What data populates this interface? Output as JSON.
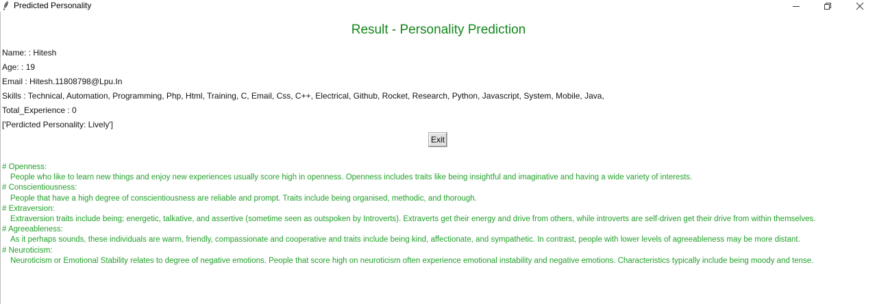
{
  "window": {
    "title": "Predicted Personality",
    "app_icon": "feather-icon",
    "controls": {
      "minimize_icon": "minimize-icon",
      "restore_icon": "restore-icon",
      "close_icon": "close-icon"
    }
  },
  "heading": "Result - Personality Prediction",
  "info": {
    "name": "Name: : Hitesh",
    "age": "Age: : 19",
    "email": "Email : Hitesh.11808798@Lpu.In",
    "skills": "Skills : Technical, Automation, Programming, Php, Html, Training, C, Email, Css, C++, Electrical, Github, Rocket, Research, Python, Javascript, System, Mobile, Java,",
    "experience": "Total_Experience : 0",
    "prediction": "['Perdicted Personality: Lively']"
  },
  "exit_button": "Exit",
  "traits": [
    {
      "header": "# Openness:",
      "body": "People who like to learn new things and enjoy new experiences usually score high in openness. Openness includes traits like being insightful and imaginative and having a wide variety of interests."
    },
    {
      "header": "# Conscientiousness:",
      "body": "People that have a high degree of conscientiousness are reliable and prompt. Traits include being organised, methodic, and thorough."
    },
    {
      "header": "# Extraversion:",
      "body": "Extraversion traits include being; energetic, talkative, and assertive (sometime seen as outspoken by Introverts). Extraverts get their energy and drive from others, while introverts are self-driven get their drive from within themselves."
    },
    {
      "header": "# Agreeableness:",
      "body": "As it perhaps sounds, these individuals are warm, friendly, compassionate and cooperative and traits include being kind, affectionate, and sympathetic. In contrast, people with lower levels of agreeableness may be more distant."
    },
    {
      "header": "# Neuroticism:",
      "body": "Neuroticism or Emotional Stability relates to degree of negative emotions. People that score high on neuroticism often experience emotional instability and negative emotions. Characteristics typically include being moody and tense."
    }
  ],
  "colors": {
    "heading": "#11861a",
    "description": "#22a02a"
  }
}
